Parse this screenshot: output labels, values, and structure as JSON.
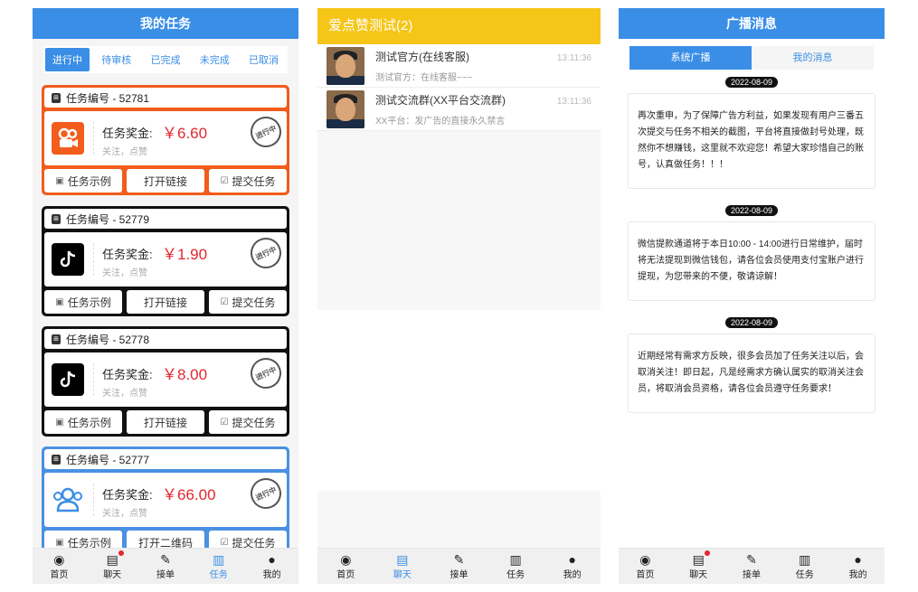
{
  "panel1": {
    "title": "我的任务",
    "tabs": [
      "进行中",
      "待审核",
      "已完成",
      "未完成",
      "已取消"
    ],
    "cards": [
      {
        "task_no": "任务编号 - 52781",
        "prize_label": "任务奖金:",
        "prize": "￥6.60",
        "sub": "关注，点赞",
        "stamp": "进行中",
        "btn1": "任务示例",
        "btn2": "打开链接",
        "btn3": "提交任务",
        "app": "kuaishou-icon"
      },
      {
        "task_no": "任务编号 - 52779",
        "prize_label": "任务奖金:",
        "prize": "￥1.90",
        "sub": "关注，点赞",
        "stamp": "进行中",
        "btn1": "任务示例",
        "btn2": "打开链接",
        "btn3": "提交任务",
        "app": "douyin-icon"
      },
      {
        "task_no": "任务编号 - 52778",
        "prize_label": "任务奖金:",
        "prize": "￥8.00",
        "sub": "关注，点赞",
        "stamp": "进行中",
        "btn1": "任务示例",
        "btn2": "打开链接",
        "btn3": "提交任务",
        "app": "douyin-icon"
      },
      {
        "task_no": "任务编号 - 52777",
        "prize_label": "任务奖金:",
        "prize": "￥66.00",
        "sub": "关注，点赞",
        "stamp": "进行中",
        "btn1": "任务示例",
        "btn2": "打开二维码",
        "btn3": "提交任务",
        "app": "users-icon"
      }
    ]
  },
  "panel2": {
    "title": "爱点赞测试(2)",
    "chats": [
      {
        "name": "测试官方(在线客服)",
        "msg": "测试官方：在线客服~~~",
        "time": "13:11:36"
      },
      {
        "name": "测试交流群(XX平台交流群)",
        "msg": "XX平台：发广告的直接永久禁言",
        "time": "13:11:36"
      }
    ]
  },
  "panel3": {
    "title": "广播消息",
    "tabs": [
      "系统广播",
      "我的消息"
    ],
    "messages": [
      {
        "date": "2022-08-09",
        "text": "再次重申，为了保障广告方利益，如果发现有用户三番五次提交与任务不相关的截图，平台将直接做封号处理，既然你不想赚钱，这里就不欢迎您！希望大家珍惜自己的账号，认真做任务！！！"
      },
      {
        "date": "2022-08-09",
        "text": "微信提款通道将于本日10:00 - 14:00进行日常维护，届时将无法提现到微信钱包，请各位会员使用支付宝账户进行提现，为您带来的不便，敬请谅解！"
      },
      {
        "date": "2022-08-09",
        "text": "近期经常有需求方反映，很多会员加了任务关注以后，会取消关注！即日起，凡是经需求方确认属实的取消关注会员，将取消会员资格，请各位会员遵守任务要求！"
      }
    ]
  },
  "nav": [
    "首页",
    "聊天",
    "接单",
    "任务",
    "我的"
  ],
  "colors": {
    "blue": "#3a8ee6",
    "yellow": "#f5c518",
    "orange": "#f25c1c",
    "red": "#e4262d"
  }
}
